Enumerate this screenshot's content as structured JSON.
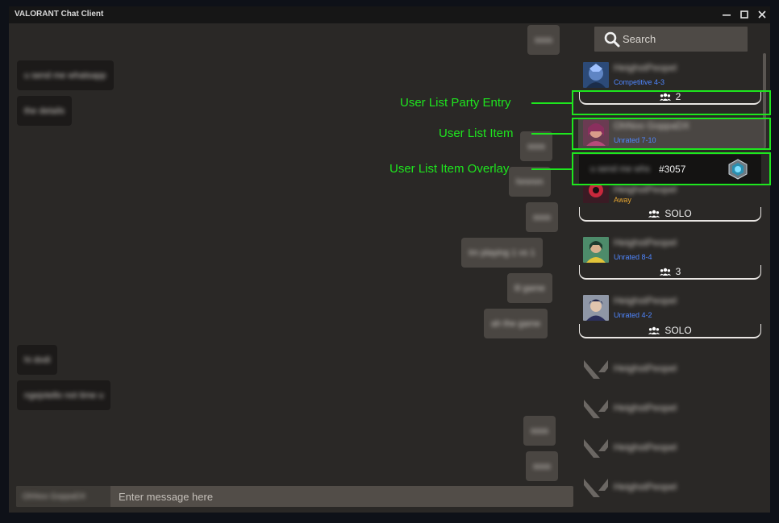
{
  "window": {
    "title": "VALORANT Chat Client"
  },
  "messages": [
    {
      "side": "out",
      "text": "ssss"
    },
    {
      "side": "in",
      "text": "u send me whatsapp"
    },
    {
      "side": "in",
      "text": "the details"
    },
    {
      "side": "out",
      "text": "ssss"
    },
    {
      "side": "out",
      "text": "hmmm"
    },
    {
      "side": "out",
      "text": "ssss"
    },
    {
      "side": "out",
      "text": "Im playing 1 vs 1"
    },
    {
      "side": "out",
      "text": "lil game"
    },
    {
      "side": "out",
      "text": "ah the game"
    },
    {
      "side": "in",
      "text": "hi dodi"
    },
    {
      "side": "in",
      "text": "ngejotello not time u"
    },
    {
      "side": "out",
      "text": "ssss"
    },
    {
      "side": "out",
      "text": "ssss"
    }
  ],
  "composer": {
    "sender": "OhNoo GoppaDX",
    "placeholder": "Enter message here"
  },
  "search": {
    "placeholder": "Search"
  },
  "users": [
    {
      "name": "HeighstPeopel",
      "status": "Competitive 4-3",
      "status_color": "#4f86ff"
    },
    {
      "name": "OhNoo GoppaDX",
      "status": "Unrated 7-10",
      "status_color": "#4f86ff"
    },
    {
      "name": "HeighstPeopel",
      "status": "Away",
      "status_color": "#e5a532"
    },
    {
      "name": "HeighstPeopel",
      "status": "Unrated 8-4",
      "status_color": "#4f86ff"
    },
    {
      "name": "HeighstPeopel",
      "status": "Unrated 4-2",
      "status_color": "#4f86ff"
    }
  ],
  "parties": [
    {
      "label": "2"
    },
    {
      "label": "SOLO"
    },
    {
      "label": "3"
    },
    {
      "label": "SOLO"
    }
  ],
  "overlay": {
    "name": "u send me whs",
    "tag": "#3057"
  },
  "offline_users": [
    "HeighstPeopel",
    "HeighstPeopel",
    "HeighstPeopel",
    "HeighstPeopel"
  ],
  "annotations": {
    "party_entry": "User List Party Entry",
    "list_item": "User List Item",
    "list_item_overlay": "User List Item Overlay",
    "color": "#1ee61e"
  }
}
